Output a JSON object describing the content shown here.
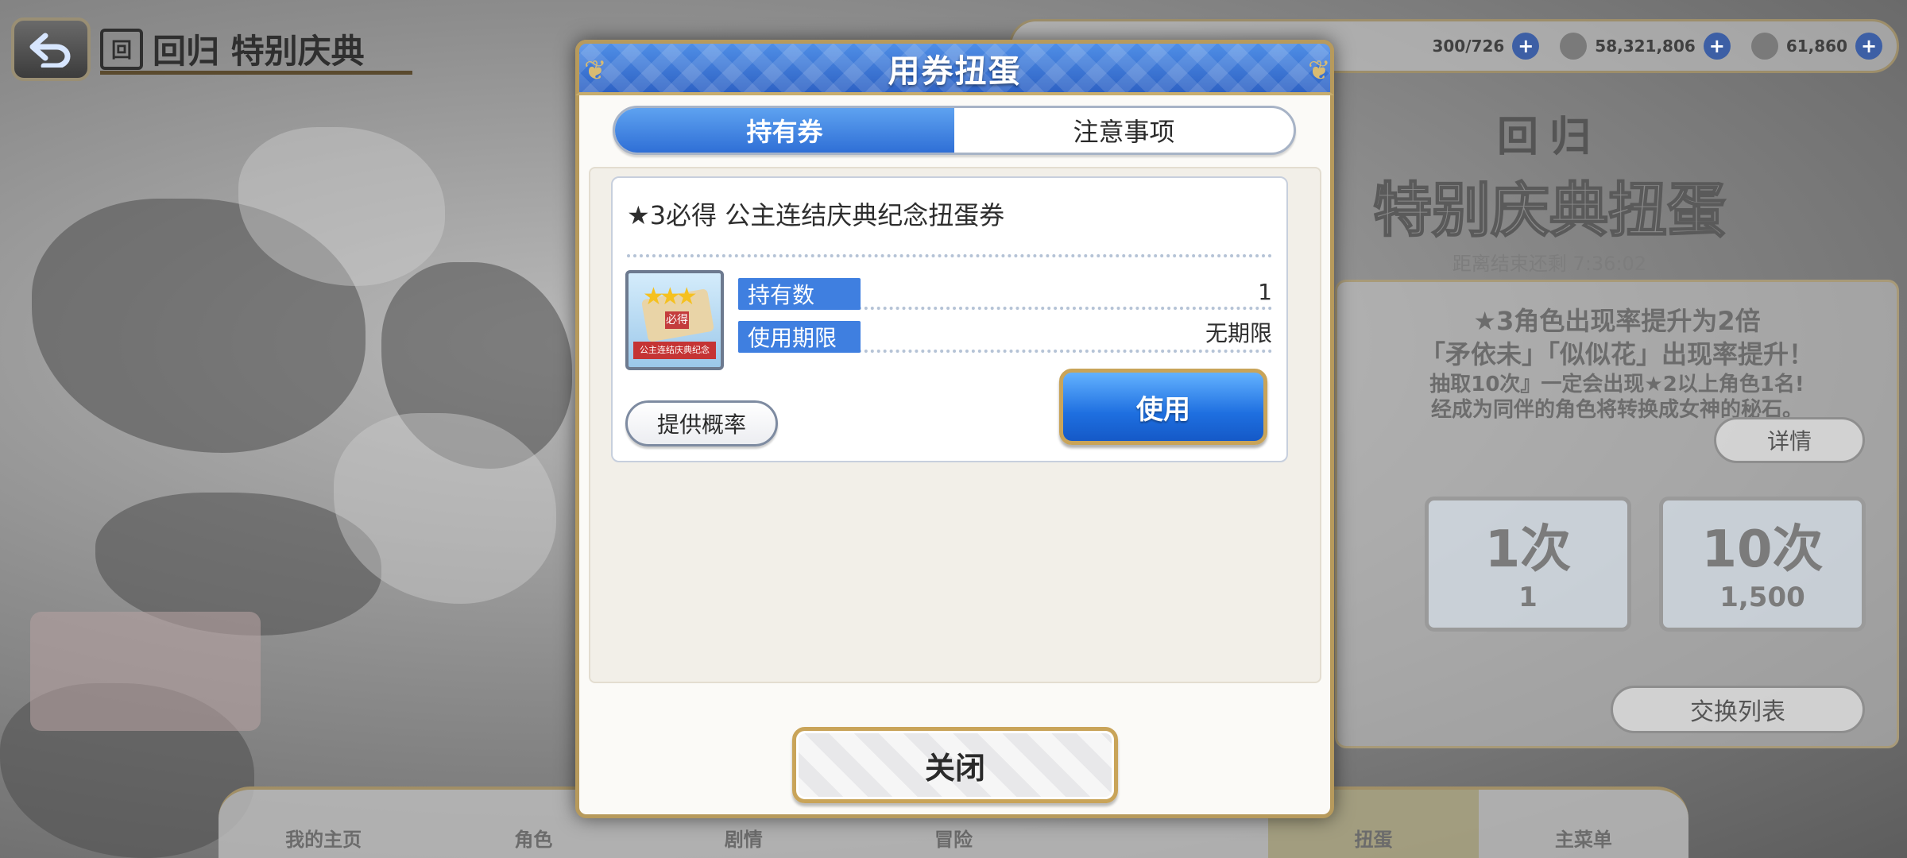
{
  "background": {
    "title": "回归 特别庆典",
    "title_icon": "回",
    "resources": [
      {
        "icon": "stamina-icon",
        "value": "300/726"
      },
      {
        "icon": "mana-icon",
        "value": "58,321,806"
      },
      {
        "icon": "jewel-icon",
        "value": "61,860"
      }
    ],
    "banner": {
      "top": "回归",
      "main": "特别庆典扭蛋",
      "sub": "距离结束还剩 7:36:02"
    },
    "info_lines": [
      "★3角色出现率提升为2倍",
      "「矛依未」「似似花」出现率提升！",
      "抽取10次』一定会出现★2以上角色1名!",
      "经成为同伴的角色将转换成女神的秘石。"
    ],
    "detail_label": "详情",
    "gacha_single": {
      "count": "1次",
      "cost": "1"
    },
    "gacha_ten": {
      "count": "10次",
      "cost": "1,500"
    },
    "exchange_label": "交换列表",
    "nav": [
      "我的主页",
      "角色",
      "剧情",
      "冒险",
      "",
      "扭蛋",
      "主菜单"
    ]
  },
  "dialog": {
    "title": "用券扭蛋",
    "tabs": [
      {
        "label": "持有券",
        "active": true
      },
      {
        "label": "注意事项",
        "active": false
      }
    ],
    "ticket": {
      "name": "★3必得  公主连结庆典纪念扭蛋券",
      "image_stamp": "必得",
      "image_caption": "公主连结庆典纪念",
      "owned_label": "持有数",
      "owned_value": "1",
      "expiry_label": "使用期限",
      "expiry_value": "无期限"
    },
    "rate_button": "提供概率",
    "use_button": "使用",
    "close_button": "关闭"
  },
  "colors": {
    "header_blue": "#2e62c4",
    "accent_blue": "#3f7fe0",
    "gold_border": "#c9a459"
  }
}
